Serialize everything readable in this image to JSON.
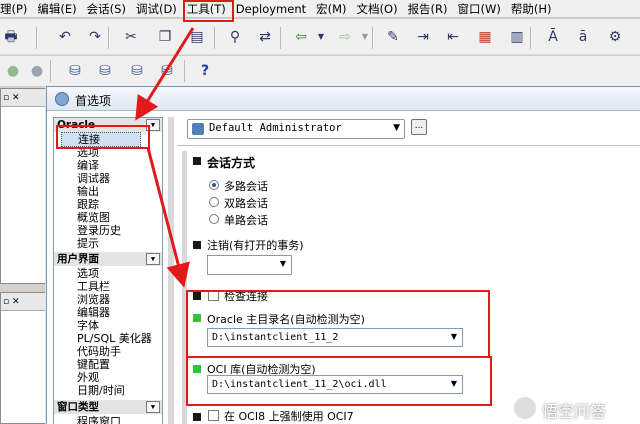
{
  "menu": [
    "理(P)",
    "编辑(E)",
    "会话(S)",
    "调试(D)",
    "工具(T)",
    "Deployment",
    "宏(M)",
    "文档(O)",
    "报告(R)",
    "窗口(W)",
    "帮助(H)"
  ],
  "dialog": {
    "title": "首选项",
    "sidebar": {
      "groups": [
        {
          "label": "Oracle",
          "items": [
            "连接",
            "选项",
            "编译",
            "调试器",
            "输出",
            "跟踪",
            "概览图",
            "登录历史",
            "提示"
          ]
        },
        {
          "label": "用户界面",
          "items": [
            "选项",
            "工具栏",
            "浏览器",
            "编辑器",
            "字体",
            "PL/SQL 美化器",
            "代码助手",
            "键配置",
            "外观",
            "日期/时间"
          ]
        },
        {
          "label": "窗口类型",
          "items": [
            "程序窗口"
          ]
        }
      ]
    },
    "profile": {
      "value": "Default Administrator",
      "more_label": "..."
    },
    "session_mode": {
      "title": "会话方式",
      "options": [
        "多路会话",
        "双路会话",
        "单路会话"
      ],
      "selected_index": 0
    },
    "logoff": {
      "label": "注销(有打开的事务)",
      "value": ""
    },
    "check_connection": {
      "label": "检查连接",
      "checked": false
    },
    "oracle_home": {
      "label": "Oracle 主目录名(自动检测为空)",
      "value": "D:\\instantclient_11_2"
    },
    "oci_library": {
      "label": "OCI 库(自动检测为空)",
      "value": "D:\\instantclient_11_2\\oci.dll"
    },
    "force_oci7": {
      "label": "在 OCI8 上强制使用 OCI7",
      "checked": false
    }
  },
  "watermark": "悟空问答",
  "annotation_color": "#e11b1b"
}
